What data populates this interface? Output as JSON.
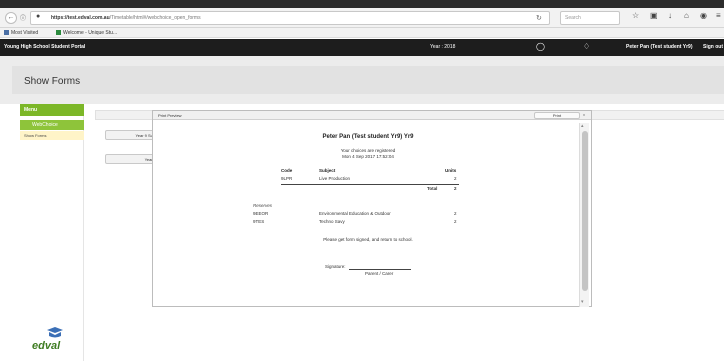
{
  "browser": {
    "url_host": "https://test.edval.com.au",
    "url_path": "/Timetable/html#/webchoice_open_forms",
    "search_placeholder": "Search",
    "back_icon": "back-arrow-icon",
    "reload_icon": "reload-icon"
  },
  "bookmarks": [
    "Most Visited",
    "Welcome - Unique Stu..."
  ],
  "portal": {
    "name": "Young High School Student Portal",
    "year_label": "Year : 2018",
    "user_label": "Peter Pan (Test student Yr9)",
    "signout_label": "Sign out"
  },
  "page": {
    "title": "Show Forms"
  },
  "sidebar": {
    "menu_label": "Menu",
    "webchoice_label": "WebChoice",
    "show_forms_label": "Show Forms",
    "logo_text": "edval"
  },
  "background_buttons": [
    "Year 9 Subj",
    "Year 9"
  ],
  "print_preview": {
    "window_title": "Print Preview",
    "print_label": "Print",
    "close_label": "x",
    "heading": "Peter Pan (Test student Yr9) Yr9",
    "registered_text": "Your choices are registered",
    "timestamp": "Mon 4 Sep 2017 17:52:04",
    "columns": {
      "code": "Code",
      "subject": "Subject",
      "units": "Units"
    },
    "choices": [
      {
        "code": "9LPR",
        "subject": "Live Production",
        "units": "2"
      }
    ],
    "total_label": "Total",
    "total_value": "2",
    "reserves_label": "Reserves",
    "reserves": [
      {
        "code": "9EEOR",
        "subject": "Environmental Education & Outdoor",
        "units": "2"
      },
      {
        "code": "9TES",
        "subject": "Techno Savy",
        "units": "2"
      }
    ],
    "instruction": "Please get form signed, and return to school.",
    "signature_label": "Signature:",
    "signature_sublabel": "Parent / Carer"
  },
  "colors": {
    "menu_green": "#7cb728",
    "header_black": "#1d1d1d",
    "logo_green": "#3e7c22"
  }
}
